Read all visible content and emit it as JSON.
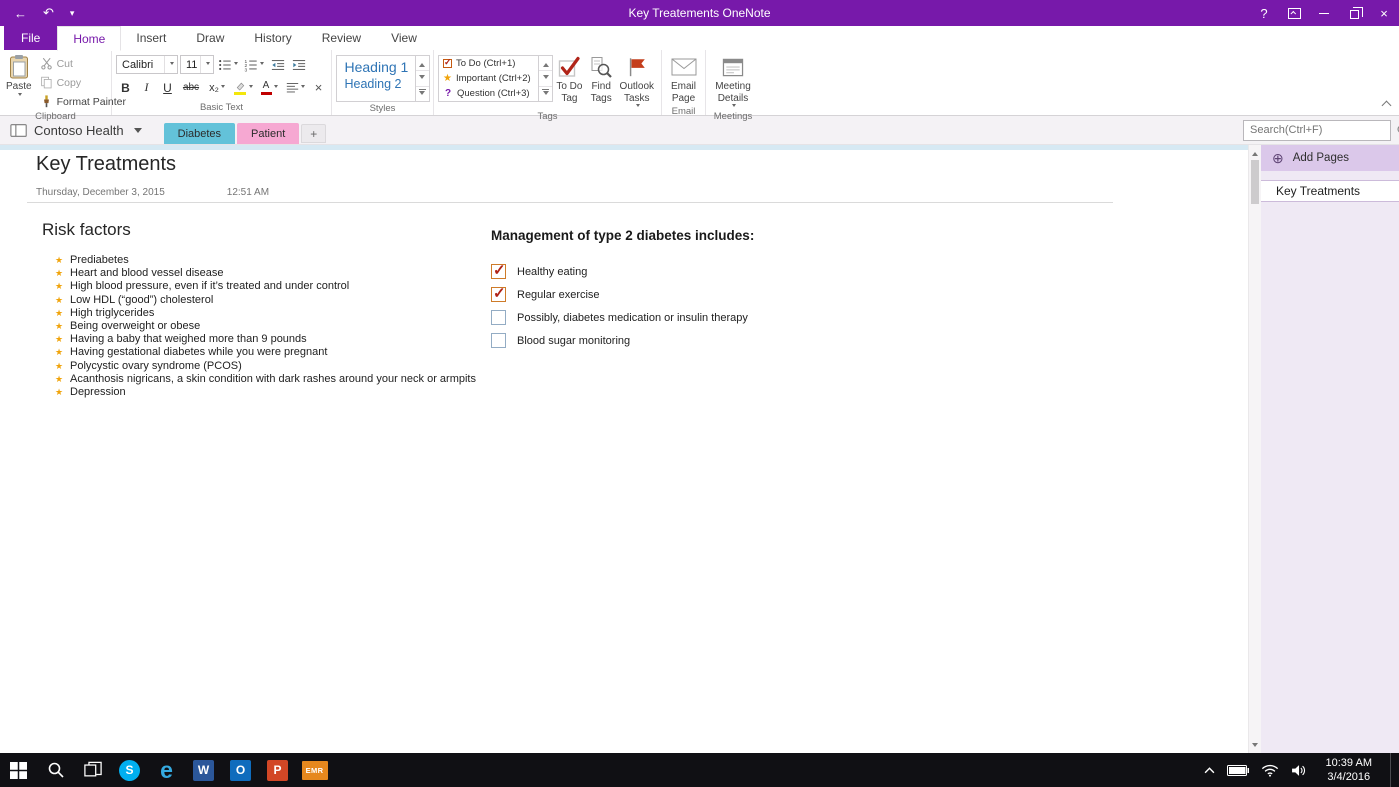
{
  "icons": {
    "back": "←",
    "undo": "↶",
    "help": "?",
    "close": "×",
    "star": "★",
    "add_circle": "⊕",
    "plus": "+"
  },
  "colors": {
    "accent": "#7719AA",
    "star": "#F0A30A",
    "check": "#B02418",
    "heading_blue": "#2E74B5",
    "section_diabetes": "#63C2D9",
    "section_patient": "#F6A8D2",
    "emr_orange": "#E6881E"
  },
  "titlebar": {
    "title": "Key Treatements OneNote"
  },
  "ribbon": {
    "tabs": [
      {
        "label": "File"
      },
      {
        "label": "Home"
      },
      {
        "label": "Insert"
      },
      {
        "label": "Draw"
      },
      {
        "label": "History"
      },
      {
        "label": "Review"
      },
      {
        "label": "View"
      }
    ],
    "clipboard": {
      "group_label": "Clipboard",
      "paste": "Paste",
      "cut": "Cut",
      "copy": "Copy",
      "format_painter": "Format Painter"
    },
    "basic_text": {
      "group_label": "Basic Text",
      "font_name": "Calibri",
      "font_size": "11",
      "bold": "B",
      "italic": "I",
      "underline": "U",
      "strike": "abc",
      "subscript": "x₂",
      "font_color_letter": "A",
      "clear": "×"
    },
    "styles": {
      "group_label": "Styles",
      "items": [
        "Heading 1",
        "Heading 2"
      ]
    },
    "tags": {
      "group_label": "Tags",
      "list": [
        "To Do (Ctrl+1)",
        "Important (Ctrl+2)",
        "Question (Ctrl+3)"
      ],
      "question_glyph": "?",
      "todo_tag_label": "To Do Tag",
      "find_tags_label": "Find Tags",
      "outlook_tasks_label": "Outlook Tasks"
    },
    "email": {
      "group_label": "Email",
      "button": "Email Page"
    },
    "meetings": {
      "group_label": "Meetings",
      "button": "Meeting Details"
    }
  },
  "navbar": {
    "notebook_name": "Contoso Health",
    "sections": [
      {
        "label": "Diabetes",
        "color": "#63C2D9",
        "active": true
      },
      {
        "label": "Patient",
        "color": "#F6A8D2",
        "active": false
      }
    ],
    "add_section": "+",
    "search_placeholder": "Search(Ctrl+F)"
  },
  "page": {
    "title": "Key Treatments",
    "date": "Thursday, December 3, 2015",
    "time": "12:51 AM",
    "risk": {
      "heading": "Risk factors",
      "items": [
        "Prediabetes",
        "Heart and blood vessel disease",
        "High blood pressure, even if it’s treated and under control",
        "Low HDL (“good”) cholesterol",
        "High triglycerides",
        "Being overweight or obese",
        "Having a baby that weighed more than 9 pounds",
        "Having gestational diabetes while you were pregnant",
        "Polycystic ovary syndrome (PCOS)",
        "Acanthosis nigricans, a skin condition with dark rashes around your  neck or armpits",
        "Depression"
      ]
    },
    "management": {
      "heading": "Management of type 2 diabetes includes:",
      "items": [
        {
          "label": "Healthy eating",
          "checked": true
        },
        {
          "label": "Regular exercise",
          "checked": true
        },
        {
          "label": "Possibly, diabetes medication or insulin therapy",
          "checked": false
        },
        {
          "label": "Blood sugar monitoring",
          "checked": false
        }
      ]
    }
  },
  "sidebar": {
    "add_pages_label": "Add Pages",
    "pages": [
      {
        "title": "Key Treatments",
        "active": true
      }
    ]
  },
  "taskbar": {
    "emr_label": "EMR",
    "skype_letter": "S",
    "edge_letter": "e",
    "word_letter": "W",
    "outlook_letter": "O",
    "powerpoint_letter": "P",
    "clock_time": "10:39 AM",
    "clock_date": "3/4/2016"
  }
}
